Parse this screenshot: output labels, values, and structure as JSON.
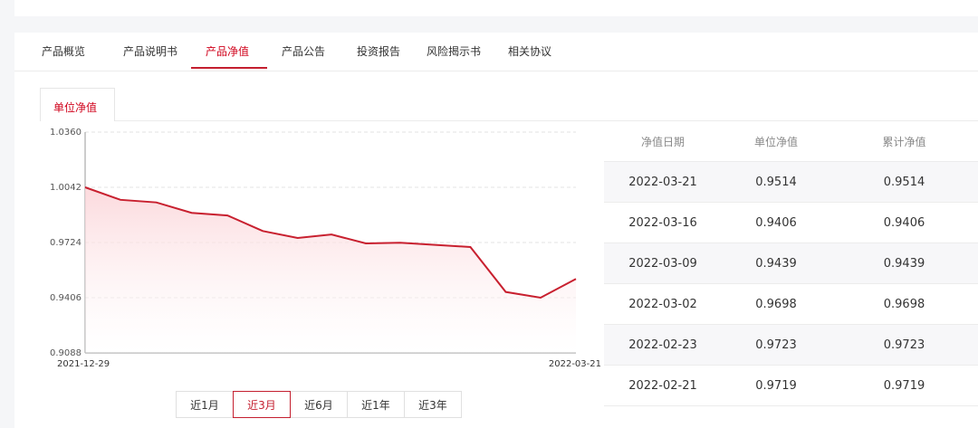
{
  "tabs": [
    {
      "label": "产品概览",
      "active": false
    },
    {
      "label": "产品说明书",
      "active": false
    },
    {
      "label": "产品净值",
      "active": true
    },
    {
      "label": "产品公告",
      "active": false
    },
    {
      "label": "投资报告",
      "active": false
    },
    {
      "label": "风险揭示书",
      "active": false
    },
    {
      "label": "相关协议",
      "active": false
    }
  ],
  "subtab": {
    "label": "单位净值"
  },
  "chart_data": {
    "type": "area",
    "x": [
      "2021-12-29",
      "2022-01-05",
      "2022-01-12",
      "2022-01-19",
      "2022-01-26",
      "2022-02-09",
      "2022-02-16",
      "2022-02-18",
      "2022-02-21",
      "2022-02-23",
      "2022-03-02",
      "2022-03-09",
      "2022-03-16",
      "2022-03-21"
    ],
    "values": [
      1.0042,
      0.997,
      0.9955,
      0.9895,
      0.988,
      0.979,
      0.975,
      0.977,
      0.9719,
      0.9723,
      0.9698,
      0.9439,
      0.9406,
      0.9514
    ],
    "yticks": [
      "1.0360",
      "1.0042",
      "0.9724",
      "0.9406",
      "0.9088"
    ],
    "ylim": [
      0.9088,
      1.036
    ],
    "xtick_labels": [
      "2021-12-29",
      "2022-03-21"
    ],
    "line_color": "#c8202f",
    "fill_color": "#fbd3d7",
    "grid": true
  },
  "ranges": [
    {
      "label": "近1月",
      "active": false
    },
    {
      "label": "近3月",
      "active": true
    },
    {
      "label": "近6月",
      "active": false
    },
    {
      "label": "近1年",
      "active": false
    },
    {
      "label": "近3年",
      "active": false
    }
  ],
  "table": {
    "headers": [
      "净值日期",
      "单位净值",
      "累计净值"
    ],
    "rows": [
      [
        "2022-03-21",
        "0.9514",
        "0.9514"
      ],
      [
        "2022-03-16",
        "0.9406",
        "0.9406"
      ],
      [
        "2022-03-09",
        "0.9439",
        "0.9439"
      ],
      [
        "2022-03-02",
        "0.9698",
        "0.9698"
      ],
      [
        "2022-02-23",
        "0.9723",
        "0.9723"
      ],
      [
        "2022-02-21",
        "0.9719",
        "0.9719"
      ]
    ]
  },
  "accent_color": "#c41f2f"
}
